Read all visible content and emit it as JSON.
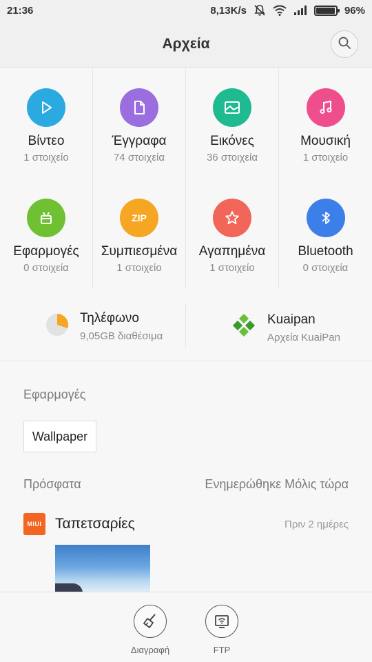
{
  "status_bar": {
    "time": "21:36",
    "net_speed": "8,13K/s",
    "battery_percent": "96%",
    "battery_level": 0.96,
    "icons": [
      "mute-icon",
      "wifi-icon",
      "signal-icon",
      "battery-icon"
    ]
  },
  "header": {
    "title": "Αρχεία",
    "search_icon": "search-icon"
  },
  "categories": [
    {
      "label": "Βίντεο",
      "count": "1 στοιχείο",
      "color": "#2ba9e1",
      "icon": "play-icon"
    },
    {
      "label": "Έγγραφα",
      "count": "74 στοιχεία",
      "color": "#9b6ee0",
      "icon": "document-icon"
    },
    {
      "label": "Εικόνες",
      "count": "36 στοιχεία",
      "color": "#1fba8f",
      "icon": "image-icon"
    },
    {
      "label": "Μουσική",
      "count": "1 στοιχείο",
      "color": "#ef4e8c",
      "icon": "music-icon"
    },
    {
      "label": "Εφαρμογές",
      "count": "0 στοιχεία",
      "color": "#6fc133",
      "icon": "android-icon"
    },
    {
      "label": "Συμπιεσμένα",
      "count": "1 στοιχείο",
      "color": "#f5a623",
      "icon": "zip-icon",
      "badge": "ZIP"
    },
    {
      "label": "Αγαπημένα",
      "count": "1 στοιχείο",
      "color": "#f2665a",
      "icon": "star-icon"
    },
    {
      "label": "Bluetooth",
      "count": "0 στοιχεία",
      "color": "#3d7fe8",
      "icon": "bluetooth-icon"
    }
  ],
  "storage": {
    "phone": {
      "title": "Τηλέφωνο",
      "subtitle": "9,05GB διαθέσιμα",
      "used_fraction": 0.3,
      "color": "#f5a623"
    },
    "kuaipan": {
      "title": "Kuaipan",
      "subtitle": "Αρχεία KuaiPan",
      "color": "#4caf50"
    }
  },
  "apps_section": {
    "title": "Εφαρμογές",
    "chips": [
      "Wallpaper"
    ]
  },
  "recent_section": {
    "title": "Πρόσφατα",
    "updated": "Ενημερώθηκε Μόλις τώρα",
    "items": [
      {
        "logo_text": "MIUI",
        "title": "Ταπετσαρίες",
        "time": "Πριν 2 ημέρες",
        "logo_color": "#f26522"
      }
    ]
  },
  "bottom_bar": {
    "delete_label": "Διαγραφή",
    "ftp_label": "FTP"
  }
}
